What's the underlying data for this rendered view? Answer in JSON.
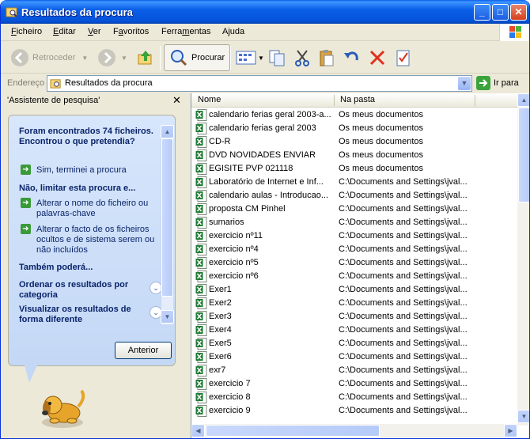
{
  "window": {
    "title": "Resultados da procura"
  },
  "menu": {
    "items": [
      {
        "label": "Ficheiro",
        "accel": "F"
      },
      {
        "label": "Editar",
        "accel": "E"
      },
      {
        "label": "Ver",
        "accel": "V"
      },
      {
        "label": "Favoritos",
        "accel": "a"
      },
      {
        "label": "Ferramentas",
        "accel": "m"
      },
      {
        "label": "Ajuda",
        "accel": "j"
      }
    ]
  },
  "toolbar": {
    "back_label": "Retroceder",
    "search_label": "Procurar"
  },
  "address": {
    "label": "Endereço",
    "value": "Resultados da procura",
    "go_label": "Ir para"
  },
  "assistant": {
    "title": "'Assistente de pesquisa'",
    "found": "Foram encontrados 74 ficheiros. Encontrou o que pretendia?",
    "done": "Sim, terminei a procura",
    "not_limit": "Não, limitar esta procura e...",
    "change_name": "Alterar o nome do ficheiro ou palavras-chave",
    "change_hidden": "Alterar o facto de os ficheiros ocultos e de sistema serem ou não incluídos",
    "also": "Também poderá...",
    "sort_by_category": "Ordenar os resultados por categoria",
    "view_different": "Visualizar os resultados de forma diferente",
    "back_button": "Anterior"
  },
  "columns": {
    "name": "Nome",
    "folder": "Na pasta"
  },
  "files": [
    {
      "name": "calendario ferias geral 2003-a...",
      "folder": "Os meus documentos"
    },
    {
      "name": "calendario ferias geral 2003",
      "folder": "Os meus documentos"
    },
    {
      "name": "CD-R",
      "folder": "Os meus documentos"
    },
    {
      "name": "DVD NOVIDADES ENVIAR",
      "folder": "Os meus documentos"
    },
    {
      "name": "EGISITE PVP 021118",
      "folder": "Os meus documentos"
    },
    {
      "name": "Laboratório de Internet e Inf...",
      "folder": "C:\\Documents and Settings\\jval..."
    },
    {
      "name": "calendario aulas - Introducao...",
      "folder": "C:\\Documents and Settings\\jval..."
    },
    {
      "name": "proposta CM Pinhel",
      "folder": "C:\\Documents and Settings\\jval..."
    },
    {
      "name": "sumarios",
      "folder": "C:\\Documents and Settings\\jval..."
    },
    {
      "name": "exercicio nº11",
      "folder": "C:\\Documents and Settings\\jval..."
    },
    {
      "name": "exercicio nº4",
      "folder": "C:\\Documents and Settings\\jval..."
    },
    {
      "name": "exercicio nº5",
      "folder": "C:\\Documents and Settings\\jval..."
    },
    {
      "name": "exercicio nº6",
      "folder": "C:\\Documents and Settings\\jval..."
    },
    {
      "name": "Exer1",
      "folder": "C:\\Documents and Settings\\jval..."
    },
    {
      "name": "Exer2",
      "folder": "C:\\Documents and Settings\\jval..."
    },
    {
      "name": "Exer3",
      "folder": "C:\\Documents and Settings\\jval..."
    },
    {
      "name": "Exer4",
      "folder": "C:\\Documents and Settings\\jval..."
    },
    {
      "name": "Exer5",
      "folder": "C:\\Documents and Settings\\jval..."
    },
    {
      "name": "Exer6",
      "folder": "C:\\Documents and Settings\\jval..."
    },
    {
      "name": "exr7",
      "folder": "C:\\Documents and Settings\\jval..."
    },
    {
      "name": "exercicio 7",
      "folder": "C:\\Documents and Settings\\jval..."
    },
    {
      "name": "exercicio 8",
      "folder": "C:\\Documents and Settings\\jval..."
    },
    {
      "name": "exercicio 9",
      "folder": "C:\\Documents and Settings\\jval..."
    }
  ],
  "colors": {
    "title_bar": "#0A5FE8",
    "excel_green": "#1E7B34",
    "link": "#0A246A"
  }
}
